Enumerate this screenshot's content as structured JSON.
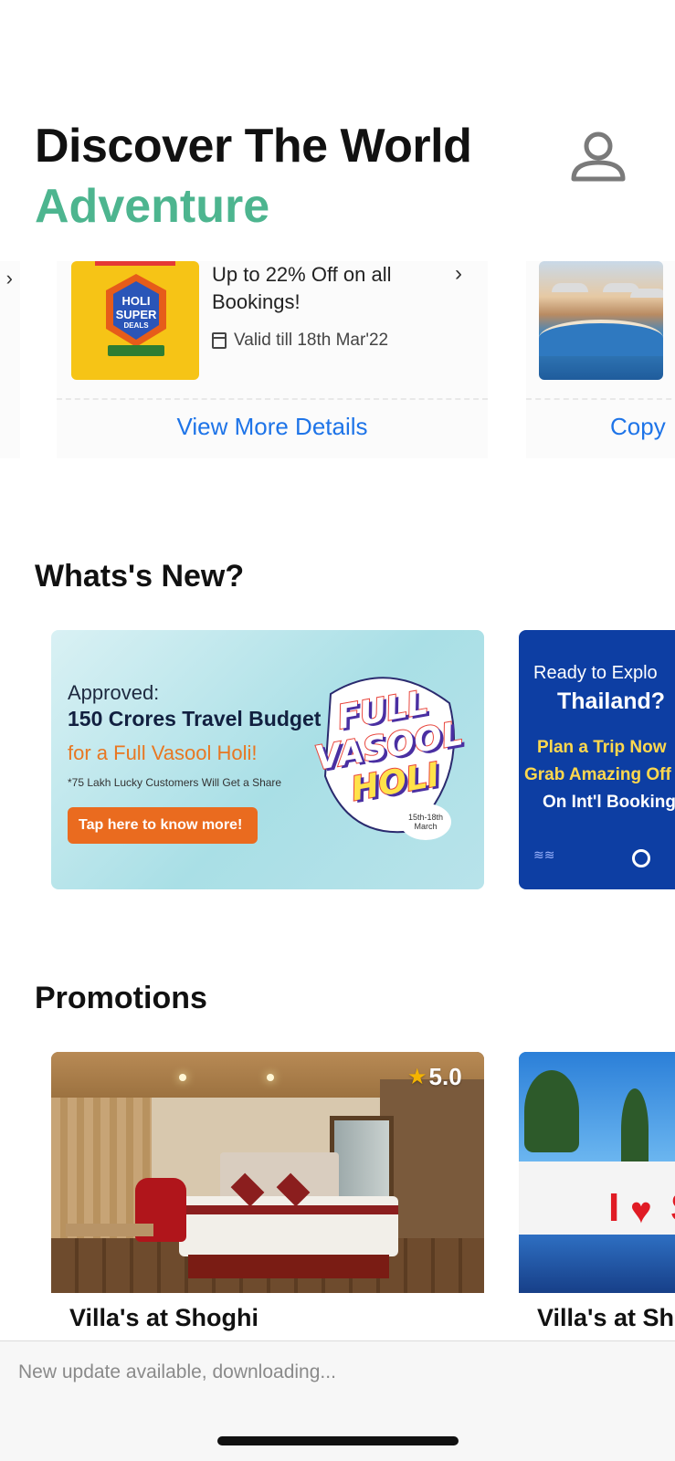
{
  "header": {
    "title": "Discover The World",
    "subtitle": "Adventure",
    "subtitle_color": "#4db58f",
    "profile_icon": "user-icon"
  },
  "offers": {
    "items": [
      {
        "badge_lines": [
          "HOLI",
          "SUPER",
          "DEALS"
        ],
        "title": "Up to 22% Off on all Bookings!",
        "valid": "Valid till 18th Mar'22",
        "link": "View More Details"
      },
      {
        "link": "Copy"
      }
    ],
    "link_color": "#1e74e8"
  },
  "whats_new": {
    "title": "Whats's New?",
    "banners": [
      {
        "approved": "Approved:",
        "headline": "150 Crores Travel Budget",
        "sub": "for a Full Vasool Holi!",
        "small": "*75 Lakh Lucky Customers Will Get a Share",
        "button": "Tap here to know more!",
        "logo_lines": [
          "FULL",
          "VASOOL",
          "HOLI"
        ],
        "date": "15th-18th March"
      },
      {
        "line1": "Ready to Explo",
        "line2": "Thailand?",
        "line3": "Plan a Trip Now",
        "line4": "Grab Amazing Off",
        "line5": "On Int'l Booking"
      }
    ]
  },
  "promotions": {
    "title": "Promotions",
    "items": [
      {
        "name": "Villa's at Shoghi",
        "rating": "5.0"
      },
      {
        "name": "Villa's at Sh"
      }
    ]
  },
  "status": {
    "update_text": "New update available, downloading..."
  }
}
